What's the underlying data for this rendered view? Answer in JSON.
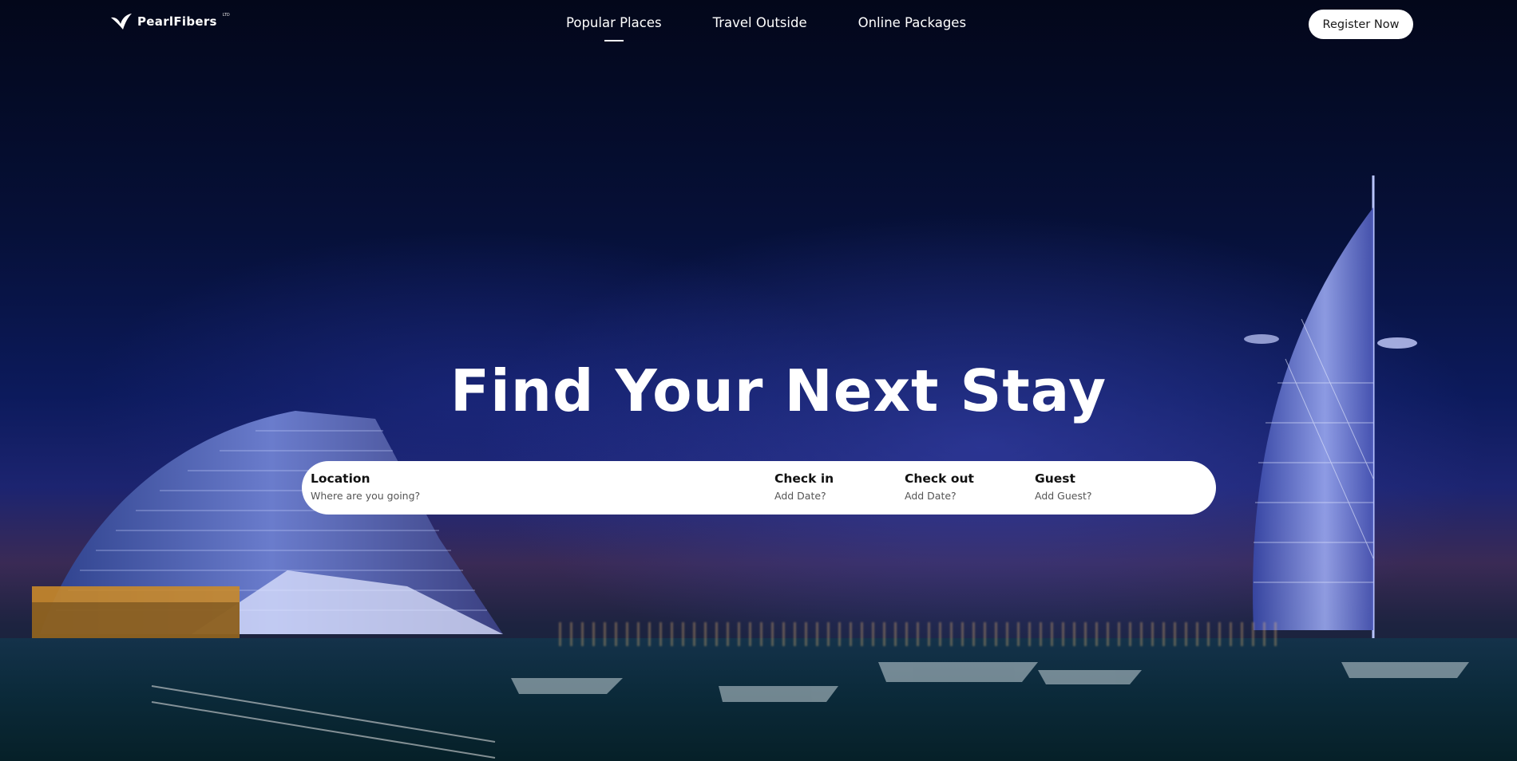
{
  "header": {
    "logo_text": "PearlFibers",
    "logo_tm": "LTD",
    "nav": [
      {
        "label": "Popular Places",
        "active": true
      },
      {
        "label": "Travel Outside",
        "active": false
      },
      {
        "label": "Online Packages",
        "active": false
      }
    ],
    "register_label": "Register Now"
  },
  "hero": {
    "headline": "Find Your Next Stay"
  },
  "search": {
    "location": {
      "label": "Location",
      "placeholder": "Where are you going?"
    },
    "check_in": {
      "label": "Check in",
      "hint": "Add Date?"
    },
    "check_out": {
      "label": "Check out",
      "hint": "Add Date?"
    },
    "guest": {
      "label": "Guest",
      "hint": "Add Guest?"
    }
  },
  "colors": {
    "background": "#061038",
    "search_bg": "#ffffff",
    "text_light": "#ffffff",
    "text_dark": "#111111"
  }
}
